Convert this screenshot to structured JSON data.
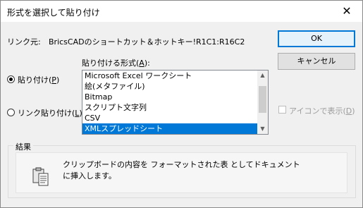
{
  "title": "形式を選択して貼り付け",
  "link": {
    "label": "リンク元:",
    "value": "BricsCADのショートカット＆ホットキー!R1C1:R16C2"
  },
  "format_label_pre": "貼り付ける形式(",
  "format_label_key": "A",
  "format_label_post": "):",
  "radios": [
    {
      "pre": "貼り付け(",
      "key": "P",
      "post": ")",
      "checked": true
    },
    {
      "pre": "リンク貼り付け(",
      "key": "L",
      "post": ")",
      "checked": false
    }
  ],
  "formats": [
    "Microsoft Excel ワークシート",
    "絵(メタファイル)",
    "Bitmap",
    "スクリプト文字列",
    "CSV",
    "XMLスプレッドシート"
  ],
  "selected_format_index": 5,
  "buttons": {
    "ok": "OK",
    "cancel": "キャンセル"
  },
  "icon_checkbox": {
    "pre": "アイコンで表示(",
    "key": "D",
    "post": ")",
    "checked": false,
    "enabled": false
  },
  "result": {
    "label": "結果",
    "line1": "クリップボードの内容を フォーマットされた表 としてドキュメント",
    "line2": "に挿入します。"
  },
  "icons": {
    "close": "close-icon",
    "clipboard": "clipboard-icon"
  }
}
